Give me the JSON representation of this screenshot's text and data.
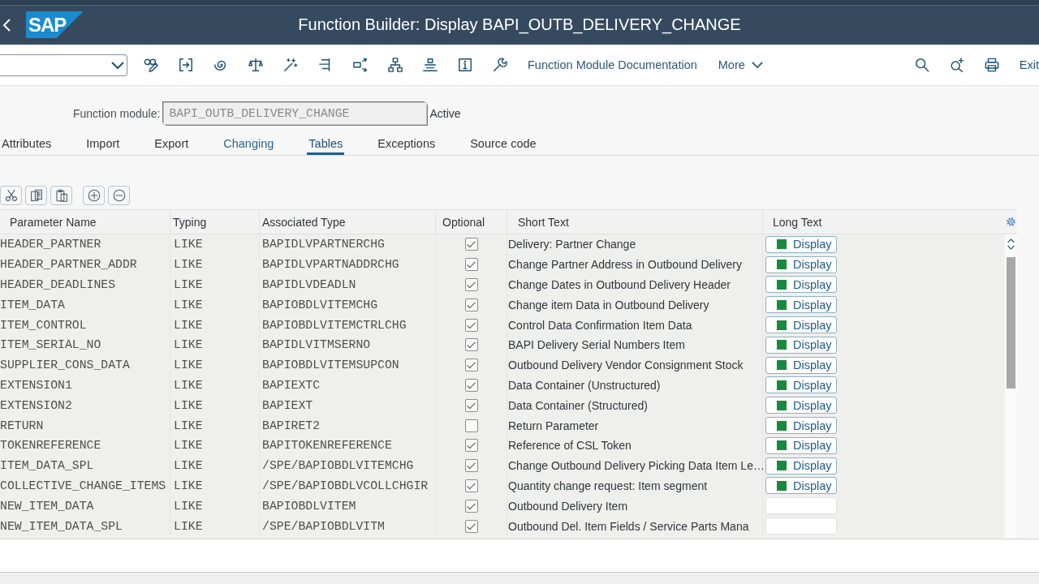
{
  "shell": {
    "logo": "SAP",
    "title": "Function Builder: Display BAPI_OUTB_DELIVERY_CHANGE"
  },
  "toolbar": {
    "buttons": [
      {
        "label": "Function Module Documentation",
        "kind": "plain"
      },
      {
        "label": "More",
        "kind": "menu"
      }
    ],
    "exit": "Exit"
  },
  "function_module": {
    "label": "Function module:",
    "value": "BAPI_OUTB_DELIVERY_CHANGE",
    "status": "Active"
  },
  "tabs": [
    {
      "label": "Attributes",
      "selected": false,
      "hovered": false
    },
    {
      "label": "Import",
      "selected": false,
      "hovered": false
    },
    {
      "label": "Export",
      "selected": false,
      "hovered": false
    },
    {
      "label": "Changing",
      "selected": false,
      "hovered": true
    },
    {
      "label": "Tables",
      "selected": true,
      "hovered": false
    },
    {
      "label": "Exceptions",
      "selected": false,
      "hovered": false
    },
    {
      "label": "Source code",
      "selected": false,
      "hovered": false
    }
  ],
  "table": {
    "columns": [
      "Parameter Name",
      "Typing",
      "Associated Type",
      "Optional",
      "Short Text",
      "Long Text"
    ],
    "rows": [
      {
        "parameter_name": "HEADER_PARTNER",
        "typing": "LIKE",
        "associated_type": "BAPIDLVPARTNERCHG",
        "optional": true,
        "short_text": "Delivery: Partner Change",
        "long_text": "Display"
      },
      {
        "parameter_name": "HEADER_PARTNER_ADDR",
        "typing": "LIKE",
        "associated_type": "BAPIDLVPARTNADDRCHG",
        "optional": true,
        "short_text": "Change Partner Address in Outbound Delivery",
        "long_text": "Display"
      },
      {
        "parameter_name": "HEADER_DEADLINES",
        "typing": "LIKE",
        "associated_type": "BAPIDLVDEADLN",
        "optional": true,
        "short_text": "Change Dates in Outbound Delivery Header",
        "long_text": "Display"
      },
      {
        "parameter_name": "ITEM_DATA",
        "typing": "LIKE",
        "associated_type": "BAPIOBDLVITEMCHG",
        "optional": true,
        "short_text": "Change item Data in Outbound Delivery",
        "long_text": "Display"
      },
      {
        "parameter_name": "ITEM_CONTROL",
        "typing": "LIKE",
        "associated_type": "BAPIOBDLVITEMCTRLCHG",
        "optional": true,
        "short_text": "Control Data Confirmation Item Data",
        "long_text": "Display"
      },
      {
        "parameter_name": "ITEM_SERIAL_NO",
        "typing": "LIKE",
        "associated_type": "BAPIDLVITMSERNO",
        "optional": true,
        "short_text": "BAPI Delivery Serial Numbers Item",
        "long_text": "Display"
      },
      {
        "parameter_name": "SUPPLIER_CONS_DATA",
        "typing": "LIKE",
        "associated_type": "BAPIOBDLVITEMSUPCON",
        "optional": true,
        "short_text": "Outbound Delivery Vendor Consignment Stock",
        "long_text": "Display"
      },
      {
        "parameter_name": "EXTENSION1",
        "typing": "LIKE",
        "associated_type": "BAPIEXTC",
        "optional": true,
        "short_text": "Data Container (Unstructured)",
        "long_text": "Display"
      },
      {
        "parameter_name": "EXTENSION2",
        "typing": "LIKE",
        "associated_type": "BAPIEXT",
        "optional": true,
        "short_text": "Data Container (Structured)",
        "long_text": "Display"
      },
      {
        "parameter_name": "RETURN",
        "typing": "LIKE",
        "associated_type": "BAPIRET2",
        "optional": false,
        "short_text": "Return Parameter",
        "long_text": "Display"
      },
      {
        "parameter_name": "TOKENREFERENCE",
        "typing": "LIKE",
        "associated_type": "BAPITOKENREFERENCE",
        "optional": true,
        "short_text": "Reference of CSL Token",
        "long_text": "Display"
      },
      {
        "parameter_name": "ITEM_DATA_SPL",
        "typing": "LIKE",
        "associated_type": "/SPE/BAPIOBDLVITEMCHG",
        "optional": true,
        "short_text": "Change Outbound Delivery Picking Data Item Le…",
        "long_text": "Display"
      },
      {
        "parameter_name": "COLLECTIVE_CHANGE_ITEMS",
        "typing": "LIKE",
        "associated_type": "/SPE/BAPIOBDLVCOLLCHGIR",
        "optional": true,
        "short_text": "Quantity change request: Item segment",
        "long_text": "Display"
      },
      {
        "parameter_name": "NEW_ITEM_DATA",
        "typing": "LIKE",
        "associated_type": "BAPIOBDLVITEM",
        "optional": true,
        "short_text": "Outbound Delivery Item"
      },
      {
        "parameter_name": "NEW_ITEM_DATA_SPL",
        "typing": "LIKE",
        "associated_type": "/SPE/BAPIOBDLVITM",
        "optional": true,
        "short_text": "Outbound Del. Item Fields / Service Parts Mana"
      }
    ]
  }
}
